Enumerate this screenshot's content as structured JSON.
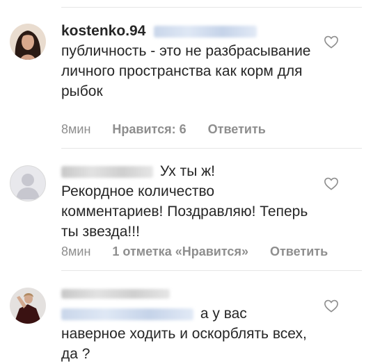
{
  "comments": [
    {
      "username": "kostenko.94",
      "text": "публичность - это не разбрасывание личного пространства как корм для рыбок",
      "time": "8мин",
      "likes": "Нравится: 6",
      "reply": "Ответить"
    },
    {
      "username": "",
      "text_first": "Ух ты ж!",
      "text": "Рекордное количество комментариев! Поздравляю! Теперь ты звезда!!!",
      "time": "8мин",
      "likes": "1 отметка «Нравится»",
      "reply": "Ответить"
    },
    {
      "username": "",
      "text_first": "а у вас",
      "text": "наверное ходить и оскорблять всех, да ?"
    }
  ],
  "icons": {
    "like": "heart-outline-icon"
  },
  "colors": {
    "text": "#262626",
    "meta": "#8e8e8e",
    "divider": "#e6e6e6",
    "mention": "#c9d6ea"
  }
}
